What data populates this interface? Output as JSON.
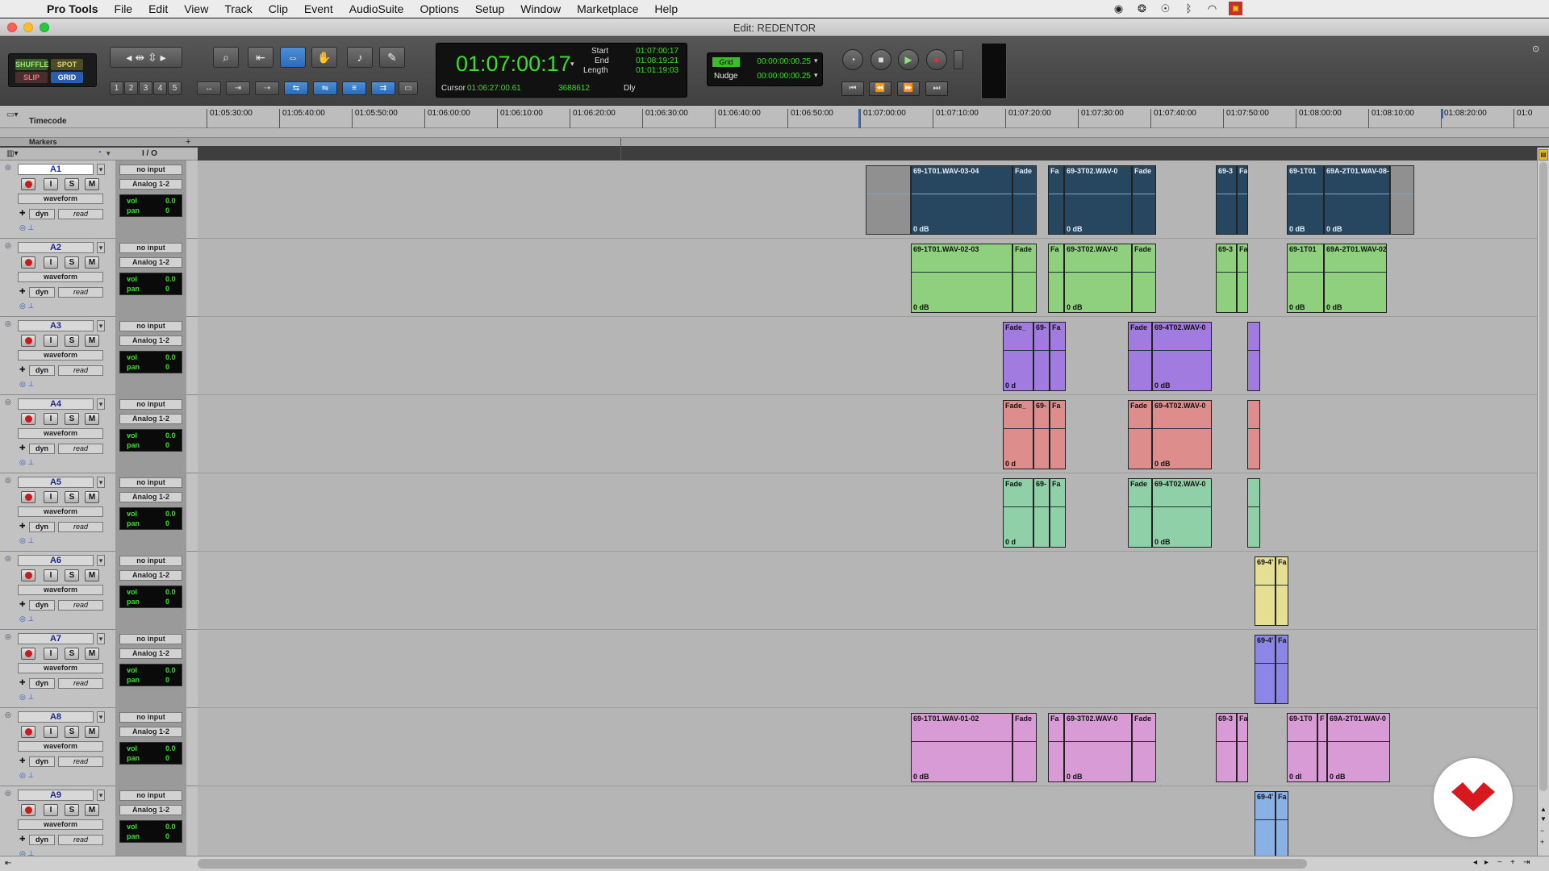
{
  "menubar": {
    "app": "Pro Tools",
    "items": [
      "File",
      "Edit",
      "View",
      "Track",
      "Clip",
      "Event",
      "AudioSuite",
      "Options",
      "Setup",
      "Window",
      "Marketplace",
      "Help"
    ]
  },
  "window": {
    "title": "Edit: REDENTOR"
  },
  "edit_modes": {
    "shuffle": "SHUFFLE",
    "spot": "SPOT",
    "slip": "SLIP",
    "grid": "GRID"
  },
  "zoom_presets": [
    "1",
    "2",
    "3",
    "4",
    "5"
  ],
  "counter": {
    "main": "01:07:00:17",
    "start_label": "Start",
    "start": "01:07:00:17",
    "end_label": "End",
    "end": "01:08:19:21",
    "length_label": "Length",
    "length": "01:01:19:03",
    "cursor_label": "Cursor",
    "cursor": "01:06:27:00.61",
    "sample": "3688612",
    "dly_label": "Dly"
  },
  "grid": {
    "grid_label": "Grid",
    "grid_value": "00:00:00:00.25",
    "nudge_label": "Nudge",
    "nudge_value": "00:00:00:00.25"
  },
  "ruler": {
    "label": "Timecode",
    "markers_label": "Markers",
    "ticks": [
      "01:05:30:00",
      "01:05:40:00",
      "01:05:50:00",
      "01:06:00:00",
      "01:06:10:00",
      "01:06:20:00",
      "01:06:30:00",
      "01:06:40:00",
      "01:06:50:00",
      "01:07:00:00",
      "01:07:10:00",
      "01:07:20:00",
      "01:07:30:00",
      "01:07:40:00",
      "01:07:50:00",
      "01:08:00:00",
      "01:08:10:00",
      "01:08:20:00",
      "01:0"
    ]
  },
  "io_header": "I / O",
  "track_common": {
    "input": "no input",
    "output": "Analog 1-2",
    "view": "waveform",
    "dyn": "dyn",
    "auto": "read",
    "vol_label": "vol",
    "vol": "0.0",
    "pan_label": "pan",
    "pan": "0",
    "rec": "",
    "input_btn": "I",
    "solo": "S",
    "mute": "M"
  },
  "tracks": [
    {
      "name": "A1",
      "color": "#1e3d57",
      "selected": true
    },
    {
      "name": "A2",
      "color": "#8fd07e"
    },
    {
      "name": "A3",
      "color": "#a27be0"
    },
    {
      "name": "A4",
      "color": "#de8d8d"
    },
    {
      "name": "A5",
      "color": "#8fd0a9"
    },
    {
      "name": "A6",
      "color": "#e6df93"
    },
    {
      "name": "A7",
      "color": "#8c86e6"
    },
    {
      "name": "A8",
      "color": "#d99bd5"
    },
    {
      "name": "A9",
      "color": "#8ab1e6"
    }
  ],
  "clips": {
    "a1": [
      {
        "name": "69-1T01.WAV-03-04",
        "db": "0 dB"
      },
      {
        "name": "Fade",
        "db": ""
      },
      {
        "name": "Fa",
        "db": ""
      },
      {
        "name": "69-3T02.WAV-0",
        "db": "0 dB"
      },
      {
        "name": "Fade",
        "db": ""
      },
      {
        "name": "69-3",
        "db": ""
      },
      {
        "name": "Fa",
        "db": ""
      },
      {
        "name": "69-1T01",
        "db": "0 dB"
      },
      {
        "name": "69A-2T01.WAV-08-",
        "db": "0 dB"
      }
    ],
    "a2": [
      {
        "name": "69-1T01.WAV-02-03",
        "db": "0 dB"
      },
      {
        "name": "Fade",
        "db": ""
      },
      {
        "name": "Fa",
        "db": ""
      },
      {
        "name": "69-3T02.WAV-0",
        "db": "0 dB"
      },
      {
        "name": "Fade",
        "db": ""
      },
      {
        "name": "69-3",
        "db": ""
      },
      {
        "name": "Fa",
        "db": ""
      },
      {
        "name": "69-1T01",
        "db": "0 dB"
      },
      {
        "name": "69A-2T01.WAV-02-",
        "db": "0 dB"
      }
    ],
    "a3": [
      {
        "name": "Fade_",
        "db": "0 d"
      },
      {
        "name": "69-",
        "db": ""
      },
      {
        "name": "Fa",
        "db": ""
      },
      {
        "name": "Fade",
        "db": ""
      },
      {
        "name": "69-4T02.WAV-0",
        "db": "0 dB"
      }
    ],
    "a4": [
      {
        "name": "Fade_",
        "db": "0 d"
      },
      {
        "name": "69-",
        "db": ""
      },
      {
        "name": "Fa",
        "db": ""
      },
      {
        "name": "Fade",
        "db": ""
      },
      {
        "name": "69-4T02.WAV-0",
        "db": "0 dB"
      }
    ],
    "a5": [
      {
        "name": "Fade",
        "db": "0 d"
      },
      {
        "name": "69-",
        "db": ""
      },
      {
        "name": "Fa",
        "db": ""
      },
      {
        "name": "Fade",
        "db": ""
      },
      {
        "name": "69-4T02.WAV-0",
        "db": "0 dB"
      }
    ],
    "a6": [
      {
        "name": "69-4'",
        "db": ""
      },
      {
        "name": "Fa",
        "db": ""
      }
    ],
    "a7": [
      {
        "name": "69-4'",
        "db": ""
      },
      {
        "name": "Fa",
        "db": ""
      }
    ],
    "a8": [
      {
        "name": "69-1T01.WAV-01-02",
        "db": "0 dB"
      },
      {
        "name": "Fade",
        "db": ""
      },
      {
        "name": "Fa",
        "db": ""
      },
      {
        "name": "69-3T02.WAV-0",
        "db": "0 dB"
      },
      {
        "name": "Fade",
        "db": ""
      },
      {
        "name": "69-3",
        "db": ""
      },
      {
        "name": "Fa",
        "db": ""
      },
      {
        "name": "69-1T0",
        "db": "0 dl"
      },
      {
        "name": "F",
        "db": ""
      },
      {
        "name": "69A-2T01.WAV-0",
        "db": "0 dB"
      }
    ],
    "a9": [
      {
        "name": "69-4'",
        "db": ""
      },
      {
        "name": "Fa",
        "db": ""
      }
    ]
  }
}
